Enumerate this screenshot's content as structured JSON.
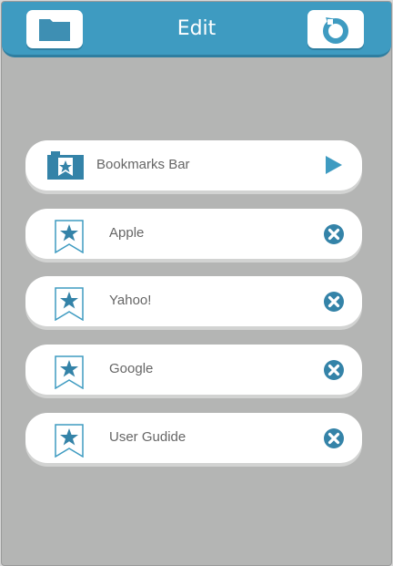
{
  "header": {
    "title": "Edit",
    "left_icon": "folder-icon",
    "right_icon": "refresh-icon"
  },
  "colors": {
    "accent": "#3e9bc1",
    "background": "#b4b5b4"
  },
  "folder": {
    "label": "Bookmarks Bar",
    "icon": "bookmark-folder-icon",
    "action_icon": "play-arrow-icon"
  },
  "bookmarks": [
    {
      "label": "Apple",
      "icon": "bookmark-star-icon",
      "action_icon": "remove-circle-icon"
    },
    {
      "label": "Yahoo!",
      "icon": "bookmark-star-icon",
      "action_icon": "remove-circle-icon"
    },
    {
      "label": "Google",
      "icon": "bookmark-star-icon",
      "action_icon": "remove-circle-icon"
    },
    {
      "label": "User Gudide",
      "icon": "bookmark-star-icon",
      "action_icon": "remove-circle-icon"
    }
  ]
}
